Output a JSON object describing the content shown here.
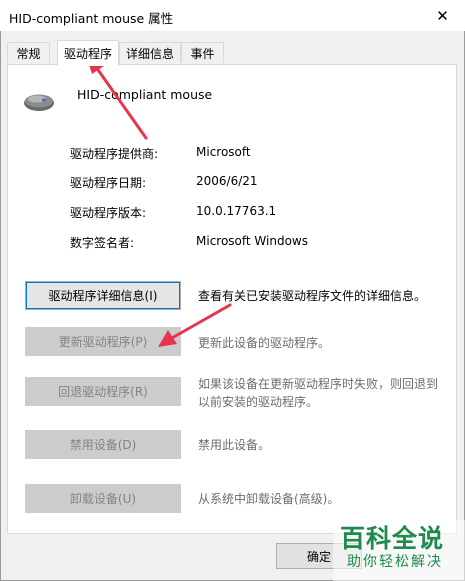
{
  "window": {
    "title": "HID-compliant mouse 属性",
    "close_glyph": "✕"
  },
  "tabs": [
    {
      "label": "常规"
    },
    {
      "label": "驱动程序"
    },
    {
      "label": "详细信息"
    },
    {
      "label": "事件"
    }
  ],
  "active_tab": "驱动程序",
  "device": {
    "icon": "mouse-icon",
    "name": "HID-compliant mouse"
  },
  "info": [
    {
      "label": "驱动程序提供商:",
      "value": "Microsoft"
    },
    {
      "label": "驱动程序日期:",
      "value": "2006/6/21"
    },
    {
      "label": "驱动程序版本:",
      "value": "10.0.17763.1"
    },
    {
      "label": "数字签名者:",
      "value": "Microsoft Windows"
    }
  ],
  "actions": [
    {
      "button": "驱动程序详细信息(I)",
      "description": "查看有关已安装驱动程序文件的详细信息。",
      "enabled": true
    },
    {
      "button": "更新驱动程序(P)",
      "description": "更新此设备的驱动程序。",
      "enabled": false
    },
    {
      "button": "回退驱动程序(R)",
      "description": "如果该设备在更新驱动程序时失败，则回退到以前安装的驱动程序。",
      "enabled": false
    },
    {
      "button": "禁用设备(D)",
      "description": "禁用此设备。",
      "enabled": false
    },
    {
      "button": "卸载设备(U)",
      "description": "从系统中卸载设备(高级)。",
      "enabled": false
    }
  ],
  "footer": {
    "ok_label": "确定"
  },
  "watermark": {
    "main": "百科全说",
    "sub": "助你轻松解决"
  },
  "colors": {
    "accent": "#0078d7",
    "annotation_arrow": "#e8344e",
    "watermark": "#1f8a4c"
  }
}
